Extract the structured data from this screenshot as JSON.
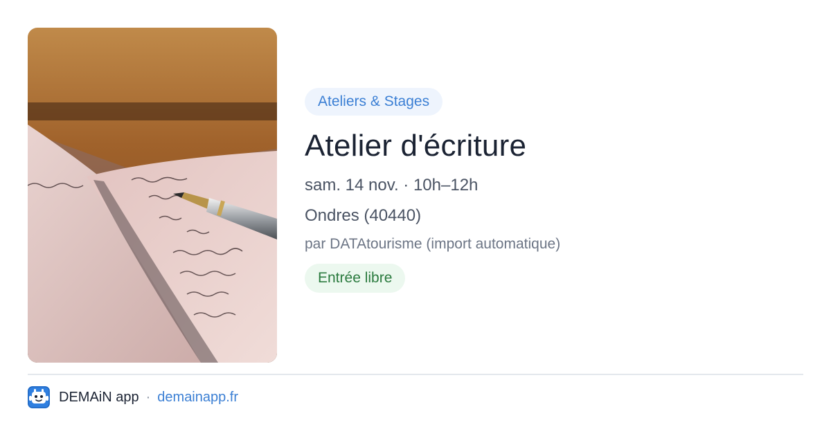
{
  "event": {
    "category": "Ateliers & Stages",
    "title": "Atelier d'écriture",
    "date_time": "sam. 14 nov. · 10h–12h",
    "location": "Ondres (40440)",
    "source": "par DATAtourisme (import automatique)",
    "price": "Entrée libre",
    "image_icon": "notebook-fountain-pen-photo"
  },
  "footer": {
    "app_name": "DEMAiN app",
    "separator": "·",
    "url": "demainapp.fr",
    "logo_icon": "demain-app-icon"
  },
  "colors": {
    "accent": "#3b7fd4",
    "category_bg": "#eef4fd",
    "price_text": "#2a7a3e",
    "price_bg": "#ecf8ef",
    "title": "#1b2333",
    "muted": "#6c7585"
  }
}
